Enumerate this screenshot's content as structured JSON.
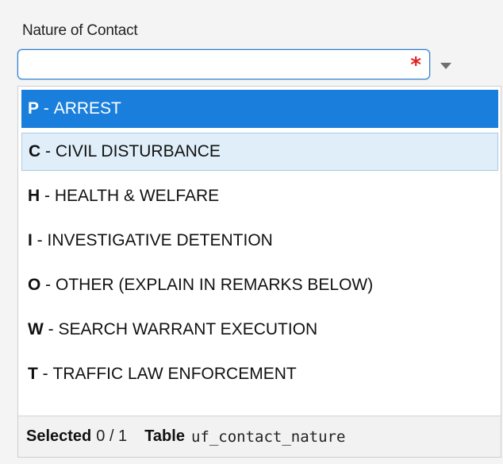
{
  "field": {
    "label": "Nature of Contact",
    "value": "",
    "required_marker": "*"
  },
  "colors": {
    "accent": "#1a7fdc",
    "hover": "#dfeef8",
    "required": "#e02020"
  },
  "options": [
    {
      "code": "P",
      "separator": " - ",
      "text": "ARREST",
      "state": "selected"
    },
    {
      "code": "C",
      "separator": " - ",
      "text": "CIVIL DISTURBANCE",
      "state": "hovered"
    },
    {
      "code": "H",
      "separator": " - ",
      "text": "HEALTH & WELFARE",
      "state": "normal"
    },
    {
      "code": "I",
      "separator": " - ",
      "text": "INVESTIGATIVE DETENTION",
      "state": "normal"
    },
    {
      "code": "O",
      "separator": " - ",
      "text": "OTHER (EXPLAIN IN REMARKS BELOW)",
      "state": "normal"
    },
    {
      "code": "W",
      "separator": " - ",
      "text": "SEARCH WARRANT EXECUTION",
      "state": "normal"
    },
    {
      "code": "T",
      "separator": " - ",
      "text": "TRAFFIC LAW ENFORCEMENT",
      "state": "normal"
    }
  ],
  "footer": {
    "selected_label": "Selected",
    "selected_value": "0 / 1",
    "table_label": "Table",
    "table_value": "uf_contact_nature"
  },
  "icons": {
    "dropdown": "chevron-down-icon",
    "required": "required-asterisk-icon"
  }
}
